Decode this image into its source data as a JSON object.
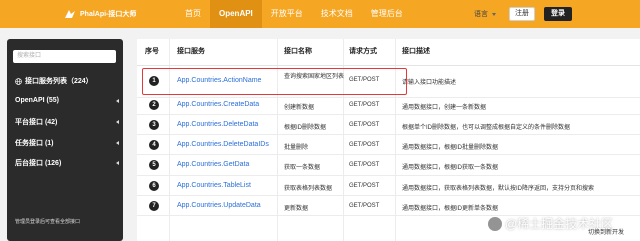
{
  "nav": {
    "brand": "PhalApi-接口大师",
    "items": [
      "首页",
      "OpenAPI",
      "开放平台",
      "技术文档",
      "管理后台"
    ],
    "active_index": 1,
    "lang": "语言",
    "register": "注册",
    "login": "登录"
  },
  "sidebar": {
    "search_placeholder": "搜索接口",
    "items": [
      {
        "label": "接口服务列表（224）",
        "icon": "globe-icon"
      },
      {
        "label": "OpenAPI (55)"
      },
      {
        "label": "平台接口 (42)"
      },
      {
        "label": "任务接口 (1)"
      },
      {
        "label": "后台接口 (126)"
      }
    ],
    "note": "管理员登录后可查看全部接口"
  },
  "table": {
    "headers": [
      "序号",
      "接口服务",
      "接口名称",
      "请求方式",
      "接口描述"
    ],
    "rows": [
      {
        "num": "1",
        "service": "App.Countries.ActionName",
        "name": "查询搜索国家地区列表",
        "method": "GET/POST",
        "desc": "请输入接口功能描述"
      },
      {
        "num": "2",
        "service": "App.Countries.CreateData",
        "name": "创建新数据",
        "method": "GET/POST",
        "desc": "通用数据接口，创建一条新数据"
      },
      {
        "num": "3",
        "service": "App.Countries.DeleteData",
        "name": "根据ID删除数据",
        "method": "GET/POST",
        "desc": "根据单个ID删除数据，也可以调整成根据自定义的条件删除数据"
      },
      {
        "num": "4",
        "service": "App.Countries.DeleteDataIDs",
        "name": "批量删除",
        "method": "GET/POST",
        "desc": "通用数据接口，根据ID批量删除数据"
      },
      {
        "num": "5",
        "service": "App.Countries.GetData",
        "name": "获取一条数据",
        "method": "GET/POST",
        "desc": "通用数据接口，根据ID获取一条数据"
      },
      {
        "num": "6",
        "service": "App.Countries.TableList",
        "name": "获取表格列表数据",
        "method": "GET/POST",
        "desc": "通用数据接口，获取表格列表数据，默认按ID降序返回，支持分页和搜索"
      },
      {
        "num": "7",
        "service": "App.Countries.UpdateData",
        "name": "更新数据",
        "method": "GET/POST",
        "desc": "通用数据接口，根据ID更新单条数据"
      }
    ]
  },
  "watermark": "@稀土掘金技术社区",
  "bottom_tip": "切换到新开发",
  "colors": {
    "nav": "#f5a623",
    "highlight": "#e23a3a",
    "link": "#2b6fd8"
  }
}
